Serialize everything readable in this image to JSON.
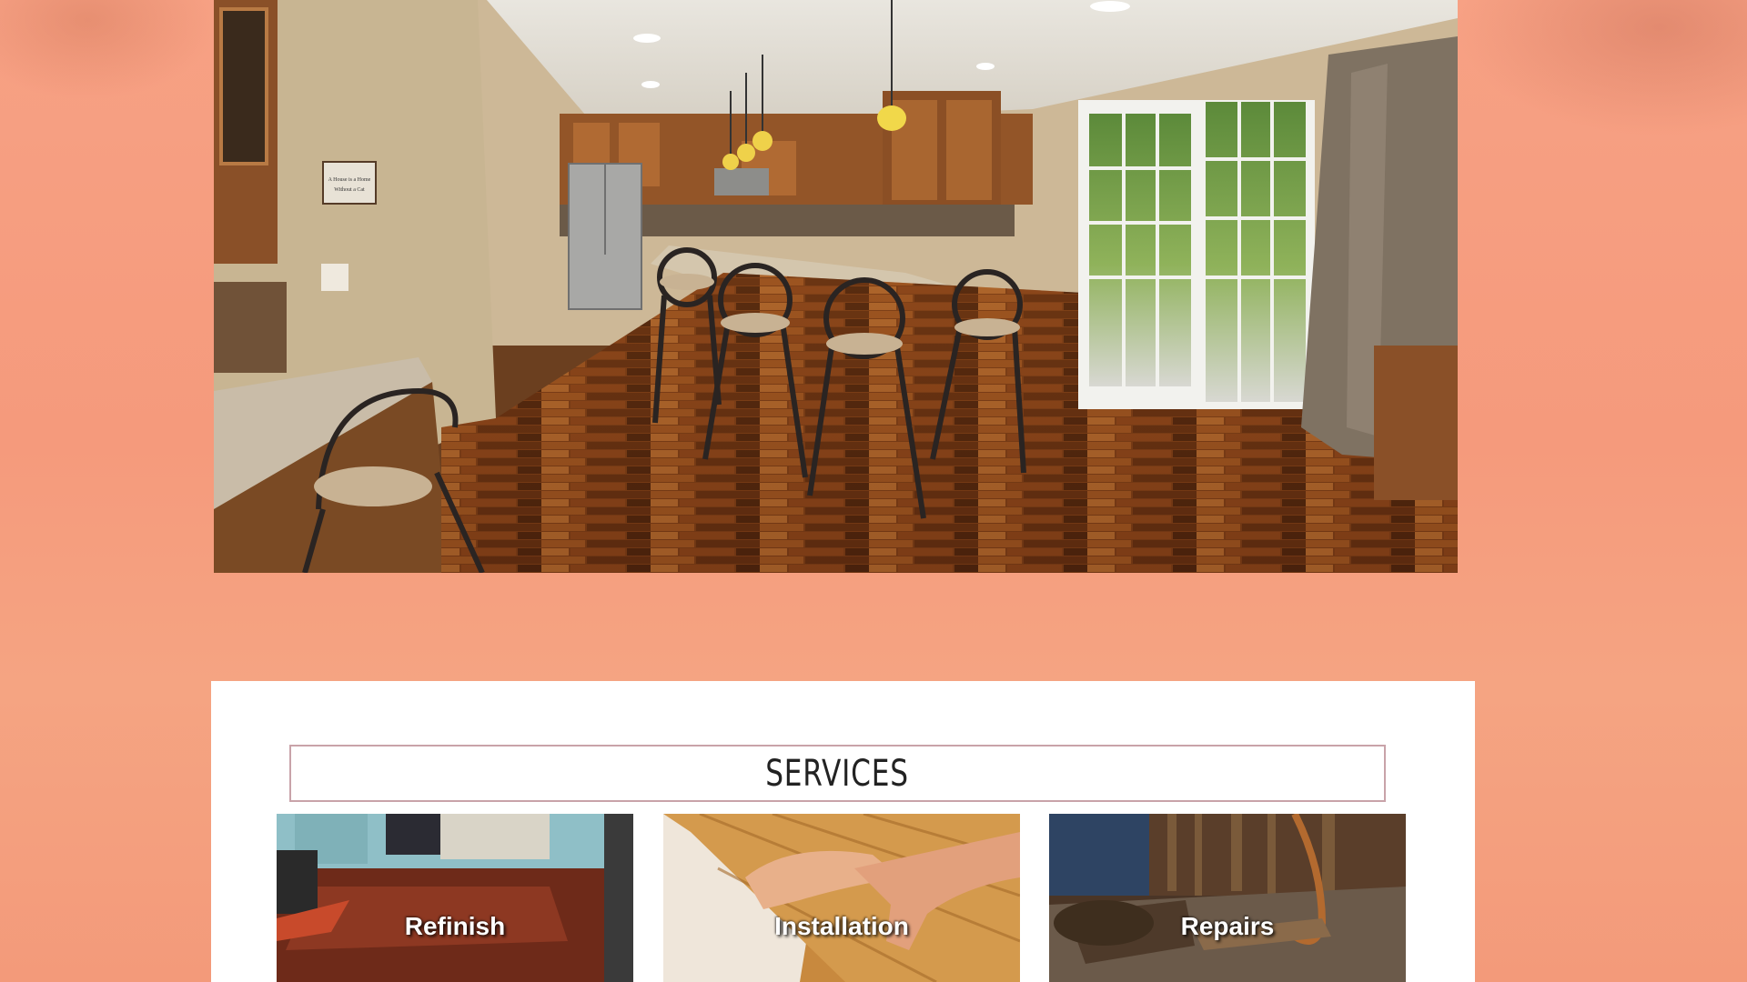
{
  "hero": {
    "image_icon": "kitchen-photo",
    "sign_text": "A House is a Home Without a Cat"
  },
  "services": {
    "title": "SERVICES",
    "cards": [
      {
        "label": "Refinish",
        "icon": "refinished-floor-photo"
      },
      {
        "label": "Installation",
        "icon": "plank-installation-photo"
      },
      {
        "label": "Repairs",
        "icon": "floor-repair-photo"
      }
    ]
  },
  "colors": {
    "background": "#f59a7c",
    "panel": "#ffffff",
    "title_border": "#c9a3a9"
  }
}
